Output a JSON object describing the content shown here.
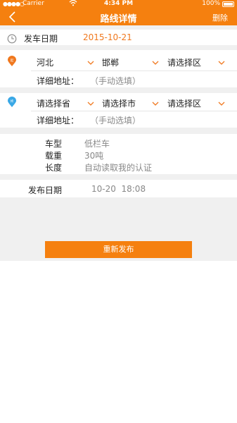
{
  "status_bar": {
    "signal": "●●●●○",
    "carrier": "Carrier",
    "time": "4:34 PM",
    "battery": "100%"
  },
  "nav": {
    "title": "路线详情",
    "delete_label": "删除"
  },
  "departure": {
    "label": "发车日期",
    "value": "2015-10-21"
  },
  "origin": {
    "province": "河北",
    "city": "邯郸",
    "district": "请选择区",
    "detail_label": "详细地址：",
    "detail_placeholder": "（手动选填）"
  },
  "destination": {
    "province": "请选择省",
    "city": "请选择市",
    "district": "请选择区",
    "detail_label": "详细地址：",
    "detail_placeholder": "（手动选填）"
  },
  "vehicle": {
    "type_label": "车型",
    "type_value": "低栏车",
    "load_label": "载重",
    "load_value": "30吨",
    "length_label": "长度",
    "length_value": "自动读取我的认证"
  },
  "publish": {
    "label": "发布日期",
    "value": "10-20  18:08"
  },
  "republish_button": "重新发布",
  "colors": {
    "accent": "#f5800f",
    "origin_pin": "#f0781e",
    "destination_pin": "#3aa8e6"
  }
}
